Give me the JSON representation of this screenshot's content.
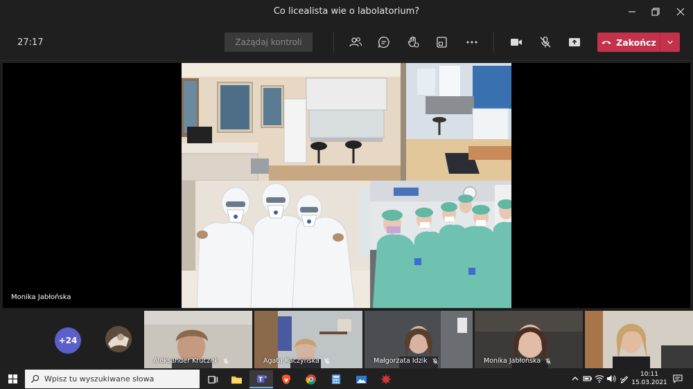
{
  "window": {
    "title": "Co licealista wie o labolatorium?"
  },
  "toolbar": {
    "timer": "27:17",
    "request_control_label": "Zażądaj kontroli",
    "end_label": "Zakończ",
    "icons": [
      "people-icon",
      "chat-icon",
      "raise-hand-icon",
      "rooms-icon",
      "more-icon",
      "camera-icon",
      "mic-off-icon",
      "share-icon",
      "hangup-icon",
      "chevron-down-icon"
    ],
    "end_color": "#c4314b"
  },
  "stage": {
    "presenter_name": "Monika Jabłońska"
  },
  "participants": {
    "overflow_count": "+24",
    "overflow_color": "#5b5fc7",
    "tiles": [
      {
        "name": "Aleksander Kruczek"
      },
      {
        "name": "Agata Kaczyńska"
      },
      {
        "name": "Małgorzata Idzik"
      },
      {
        "name": "Monika Jabłońska"
      },
      {
        "name": ""
      }
    ]
  },
  "taskbar": {
    "search_placeholder": "Wpisz tu wyszukiwane słowa",
    "time": "10:11",
    "date": "15.03.2021"
  }
}
